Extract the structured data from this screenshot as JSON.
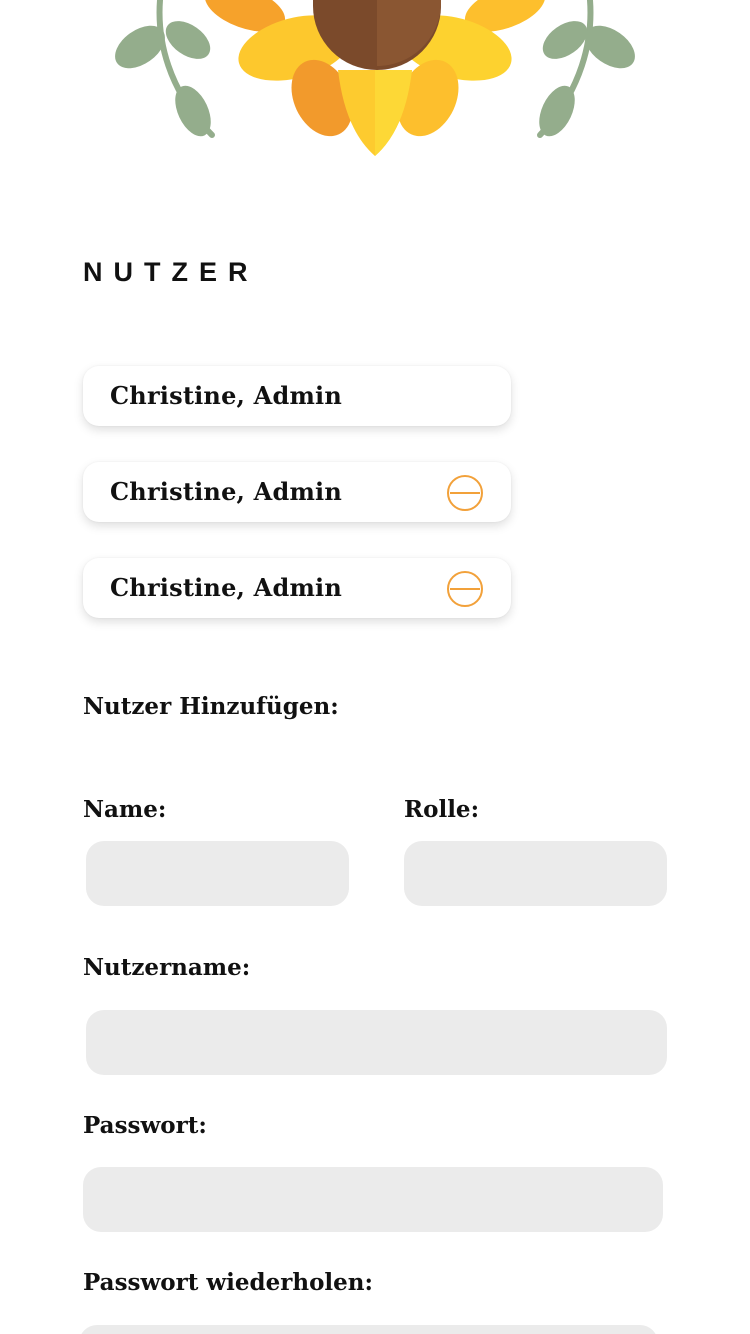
{
  "section": {
    "title": "NUTZER"
  },
  "users": [
    {
      "label": "Christine, Admin",
      "removable": false
    },
    {
      "label": "Christine, Admin",
      "removable": true
    },
    {
      "label": "Christine, Admin",
      "removable": true
    }
  ],
  "add_user_form": {
    "heading": "Nutzer Hinzufügen:",
    "name_label": "Name:",
    "name_value": "",
    "role_label": "Rolle:",
    "role_value": "",
    "username_label": "Nutzername:",
    "username_value": "",
    "password_label": "Passwort:",
    "password_value": "",
    "password_repeat_label": "Passwort wiederholen:",
    "password_repeat_value": ""
  },
  "icons": {
    "hero": "sunflower-icon",
    "remove": "minus-circle-icon"
  },
  "colors": {
    "accent": "#f2a13a",
    "input_background": "#ebebeb",
    "text": "#111111",
    "leaf": "#94ad8c",
    "petal_light": "#fdd22f",
    "petal_dark": "#f6a22b",
    "seed": "#7b4a2b"
  }
}
